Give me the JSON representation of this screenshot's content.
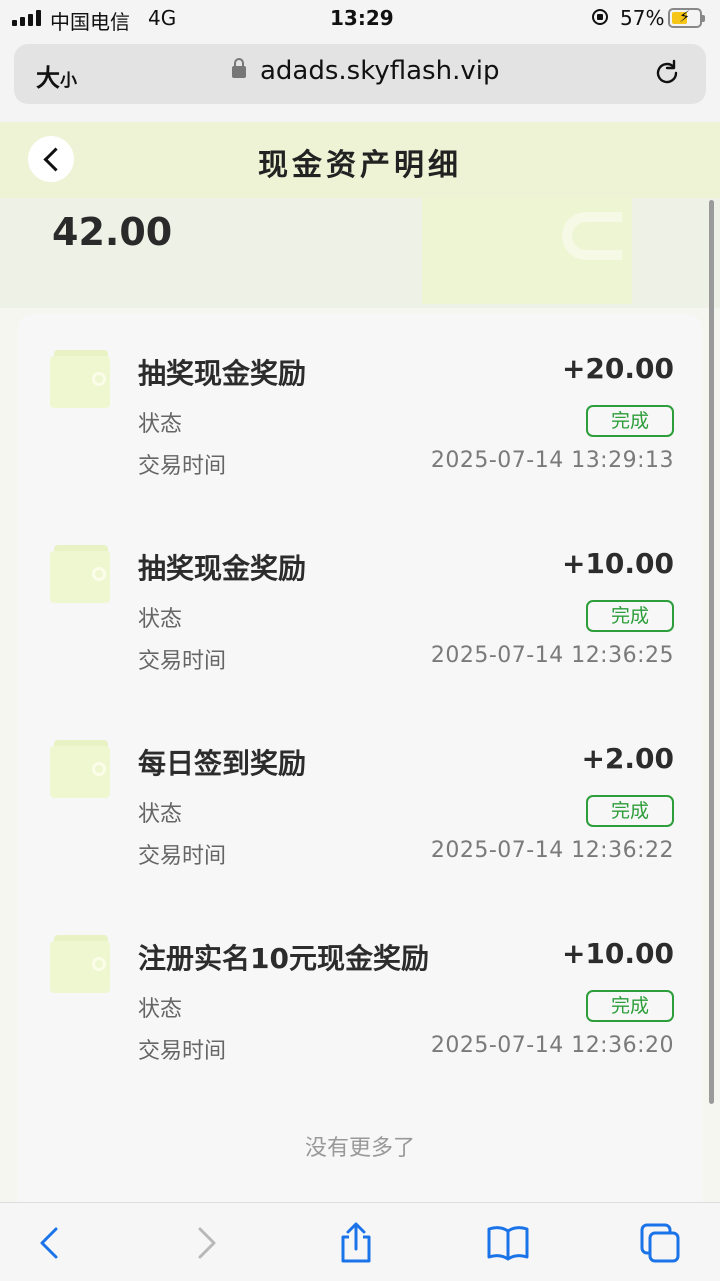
{
  "status_bar": {
    "carrier": "中国电信",
    "network": "4G",
    "time": "13:29",
    "battery_percent": "57%",
    "battery_level": 0.57
  },
  "browser": {
    "text_size_label_big": "大",
    "text_size_label_small": "小",
    "domain": "adads.skyflash.vip"
  },
  "header": {
    "title": "现金资产明细"
  },
  "balance": {
    "amount": "42.00"
  },
  "transactions": [
    {
      "name": "抽奖现金奖励",
      "amount": "+20.00",
      "status_label": "状态",
      "status": "完成",
      "time_label": "交易时间",
      "time": "2025-07-14 13:29:13"
    },
    {
      "name": "抽奖现金奖励",
      "amount": "+10.00",
      "status_label": "状态",
      "status": "完成",
      "time_label": "交易时间",
      "time": "2025-07-14 12:36:25"
    },
    {
      "name": "每日签到奖励",
      "amount": "+2.00",
      "status_label": "状态",
      "status": "完成",
      "time_label": "交易时间",
      "time": "2025-07-14 12:36:22"
    },
    {
      "name": "注册实名10元现金奖励",
      "amount": "+10.00",
      "status_label": "状态",
      "status": "完成",
      "time_label": "交易时间",
      "time": "2025-07-14 12:36:20"
    }
  ],
  "list_end_text": "没有更多了",
  "colors": {
    "status_green": "#2d9e3a",
    "header_bg": "#eef3d6",
    "wallet_icon": "#eef7d0"
  },
  "icons": {
    "back": "chevron-left-icon",
    "reload": "reload-icon",
    "wallet": "wallet-icon",
    "share": "share-icon",
    "bookmarks": "book-icon",
    "tabs": "tabs-icon"
  }
}
